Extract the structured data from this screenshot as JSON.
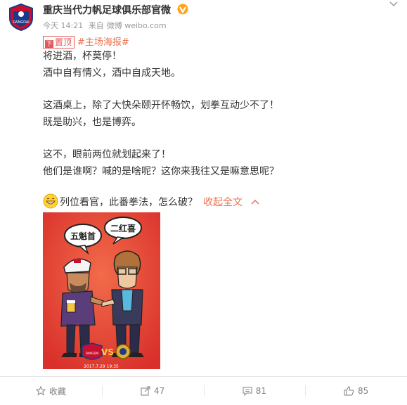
{
  "author": {
    "name": "重庆当代力帆足球俱乐部官微",
    "avatar_text": "DANGDAI"
  },
  "meta": {
    "time": "今天 14:21",
    "source_prefix": "来自",
    "source": "微博 weibo.com"
  },
  "pin": {
    "label": "置顶",
    "icon_text": "下"
  },
  "topic": "#主场海报#",
  "content": {
    "line1": "将进酒，杯莫停！",
    "line2": "酒中自有情义，酒中自成天地。",
    "line3": "这酒桌上，除了大快朵颐开怀畅饮，划拳互动少不了！",
    "line4": "既是助兴，也是博弈。",
    "line5": "这不，眼前两位就划起来了！",
    "line6": "他们是谁啊？喊的是啥呢？这你来我往又是嘛意思呢？",
    "line7": "列位看官，此番拳法，怎么破？",
    "fold": "收起全文"
  },
  "poster": {
    "bubble_left": "五魁首",
    "bubble_right": "二红喜",
    "logo_left": "DANGDAI",
    "vs": "VS",
    "date": "2017.7.29 19:35"
  },
  "footer": {
    "favorite": "收藏",
    "repost": "47",
    "comment": "81",
    "like": "85"
  },
  "colors": {
    "accent": "#eb7350",
    "poster_bg": "#e8453c",
    "verified": "#ffa41a"
  }
}
